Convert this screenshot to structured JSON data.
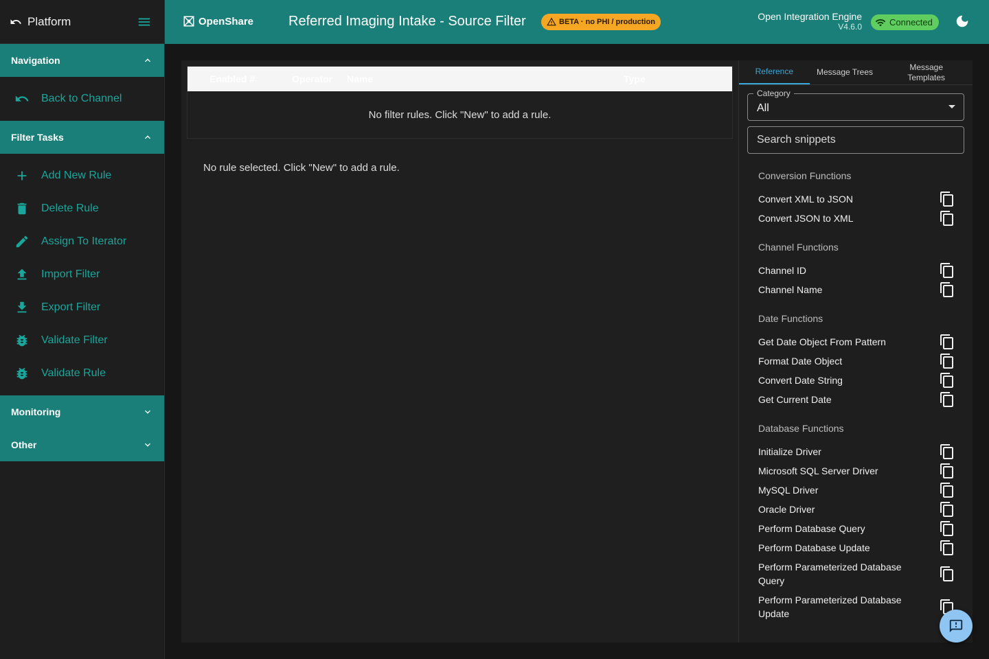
{
  "sidebar": {
    "title": "Platform",
    "sections": [
      {
        "label": "Navigation",
        "expanded": true,
        "items": [
          {
            "label": "Back to Channel",
            "icon": "undo-icon"
          }
        ]
      },
      {
        "label": "Filter Tasks",
        "expanded": true,
        "items": [
          {
            "label": "Add New Rule",
            "icon": "plus-icon"
          },
          {
            "label": "Delete Rule",
            "icon": "trash-icon"
          },
          {
            "label": "Assign To Iterator",
            "icon": "pencil-icon"
          },
          {
            "label": "Import Filter",
            "icon": "upload-icon"
          },
          {
            "label": "Export Filter",
            "icon": "download-icon"
          },
          {
            "label": "Validate Filter",
            "icon": "bug-icon"
          },
          {
            "label": "Validate Rule",
            "icon": "bug-icon"
          }
        ]
      },
      {
        "label": "Monitoring",
        "expanded": false
      },
      {
        "label": "Other",
        "expanded": false
      }
    ]
  },
  "header": {
    "logo": "OpenShare",
    "title": "Referred Imaging Intake - Source Filter",
    "badge": "BETA · no PHI / production",
    "engine_name": "Open Integration Engine",
    "version": "V4.6.0",
    "status": "Connected"
  },
  "rules_table": {
    "columns": [
      "Enabled #",
      "Operator",
      "Name",
      "Type"
    ],
    "empty_text": "No filter rules. Click \"New\" to add a rule."
  },
  "detail": {
    "empty_text": "No rule selected. Click \"New\" to add a rule."
  },
  "reference": {
    "tabs": [
      "Reference",
      "Message Trees",
      "Message Templates"
    ],
    "active_tab": "Reference",
    "category_label": "Category",
    "category_value": "All",
    "search_placeholder": "Search snippets",
    "groups": [
      {
        "title": "Conversion Functions",
        "items": [
          "Convert XML to JSON",
          "Convert JSON to XML"
        ]
      },
      {
        "title": "Channel Functions",
        "items": [
          "Channel ID",
          "Channel Name"
        ]
      },
      {
        "title": "Date Functions",
        "items": [
          "Get Date Object From Pattern",
          "Format Date Object",
          "Convert Date String",
          "Get Current Date"
        ]
      },
      {
        "title": "Database Functions",
        "items": [
          "Initialize Driver",
          "Microsoft SQL Server Driver",
          "MySQL Driver",
          "Oracle Driver",
          "Perform Database Query",
          "Perform Database Update",
          "Perform Parameterized Database Query",
          "Perform Parameterized Database Update"
        ]
      }
    ]
  },
  "colors": {
    "accent": "#1a7f78",
    "link": "#1aa69b",
    "tab_active": "#3aa8d8",
    "badge": "#f5a623",
    "status": "#5fce5f"
  }
}
